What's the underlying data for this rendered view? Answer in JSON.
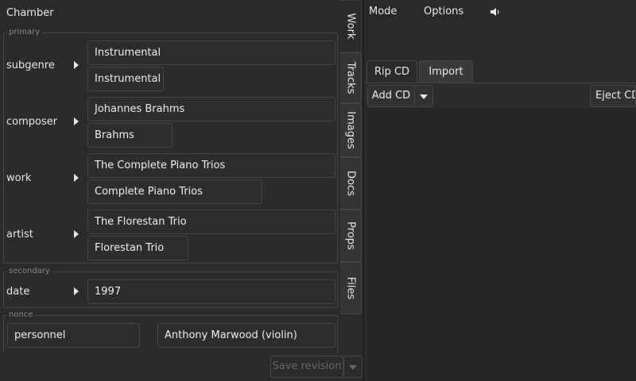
{
  "header": {
    "title": "Chamber"
  },
  "primary": {
    "legend": "primary",
    "rows": [
      {
        "label": "subgenre",
        "value": "Instrumental",
        "short": "Instrumental"
      },
      {
        "label": "composer",
        "value": "Johannes Brahms",
        "short": "Brahms"
      },
      {
        "label": "work",
        "value": "The Complete Piano Trios",
        "short": "Complete Piano Trios"
      },
      {
        "label": "artist",
        "value": "The Florestan Trio",
        "short": "Florestan Trio"
      }
    ]
  },
  "secondary": {
    "legend": "secondary",
    "rows": [
      {
        "label": "date",
        "value": "1997"
      }
    ]
  },
  "nonce": {
    "legend": "nonce",
    "key": "personnel",
    "value": "Anthony Marwood (violin)"
  },
  "side_tabs": [
    "Work",
    "Tracks",
    "Images",
    "Docs",
    "Props",
    "Files"
  ],
  "save": {
    "label": "Save revision"
  },
  "menu": {
    "mode": "Mode",
    "options": "Options"
  },
  "tabs": [
    "Rip CD",
    "Import"
  ],
  "toolbar": {
    "add_cd": "Add CD",
    "eject_cd": "Eject CD"
  }
}
